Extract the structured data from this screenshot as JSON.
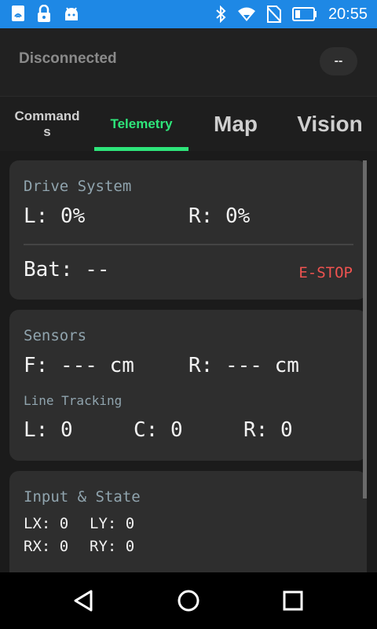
{
  "status_bar": {
    "time": "20:55",
    "left_icons": [
      "nfc-sim-icon",
      "lock-icon",
      "android-icon"
    ],
    "right_icons": [
      "bluetooth-icon",
      "wifi-icon",
      "no-sim-icon",
      "battery-icon"
    ]
  },
  "connection": {
    "status": "Disconnected",
    "pill": "--"
  },
  "tabs": [
    {
      "label": "Commands"
    },
    {
      "label": "Telemetry",
      "active": true
    },
    {
      "label": "Map"
    },
    {
      "label": "Vision"
    }
  ],
  "drive": {
    "title": "Drive System",
    "left": "L: 0%",
    "right": "R: 0%",
    "battery": "Bat: --",
    "estop": "E-STOP"
  },
  "sensors": {
    "title": "Sensors",
    "front": "F: --- cm",
    "rear": "R: --- cm",
    "line_title": "Line Tracking",
    "line_left": "L: 0",
    "line_center": "C: 0",
    "line_right": "R: 0"
  },
  "input": {
    "title": "Input & State",
    "lx": "LX: 0",
    "ly": "LY: 0",
    "rx": "RX: 0",
    "ry": "RY: 0"
  },
  "colors": {
    "status_bar": "#1e88e5",
    "accent": "#2ee57a",
    "estop": "#ef5350",
    "card": "#2e2e2e"
  }
}
